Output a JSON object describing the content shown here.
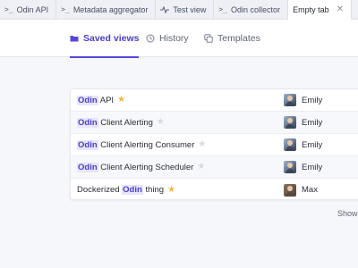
{
  "tabs": [
    {
      "label": "Odin API",
      "icon": "terminal-icon"
    },
    {
      "label": "Metadata aggregator",
      "icon": "terminal-icon"
    },
    {
      "label": "Test view",
      "icon": "pulse-icon"
    },
    {
      "label": "Odin collector",
      "icon": "terminal-icon"
    },
    {
      "label": "Empty tab",
      "icon": "",
      "active": true
    }
  ],
  "view_tabs": [
    {
      "label": "Saved views",
      "icon": "folder-icon",
      "active": true
    },
    {
      "label": "History",
      "icon": "clock-icon"
    },
    {
      "label": "Templates",
      "icon": "copy-icon"
    }
  ],
  "rows": [
    {
      "prefix": "",
      "highlight": "Odin",
      "suffix": " API",
      "starred": true,
      "owner": "Emily"
    },
    {
      "prefix": "",
      "highlight": "Odin",
      "suffix": " Client Alerting",
      "starred": false,
      "owner": "Emily"
    },
    {
      "prefix": "",
      "highlight": "Odin",
      "suffix": " Client Alerting Consumer",
      "starred": false,
      "owner": "Emily"
    },
    {
      "prefix": "",
      "highlight": "Odin",
      "suffix": " Client Alerting Scheduler",
      "starred": false,
      "owner": "Emily"
    },
    {
      "prefix": "Dockerized ",
      "highlight": "Odin",
      "suffix": " thing",
      "starred": true,
      "owner": "Max"
    }
  ],
  "show_label": "Show",
  "colors": {
    "accent": "#5546d8",
    "highlight_bg": "#e7e5fb",
    "star_on": "#f3b642",
    "star_off": "#d6d9e2"
  }
}
